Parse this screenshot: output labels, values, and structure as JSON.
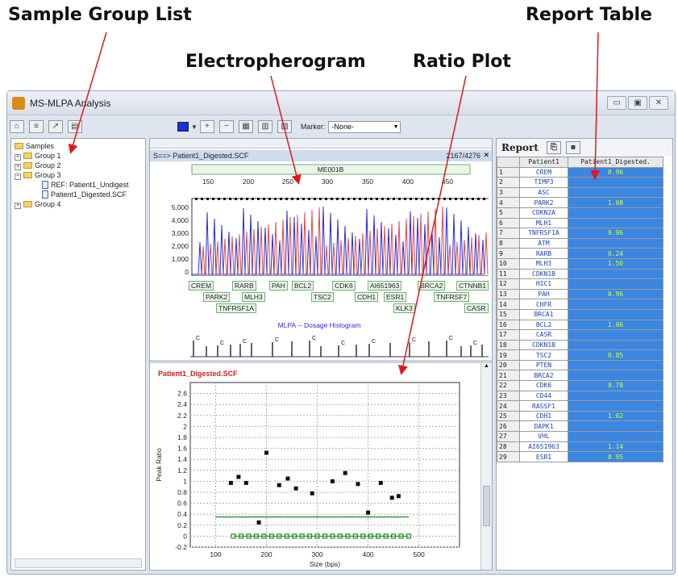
{
  "callouts": {
    "sample_group_list": "Sample Group List",
    "report_table": "Report Table",
    "electropherogram": "Electropherogram",
    "ratio_plot": "Ratio Plot"
  },
  "window": {
    "title": "MS-MLPA Analysis",
    "controls": [
      "▭",
      "▣",
      "✕"
    ]
  },
  "toolbar": {
    "marker_label": "Marker:",
    "marker_value": "-None-",
    "color_swatch": "#1c2fd6"
  },
  "tree": {
    "root": "Samples",
    "items": [
      {
        "label": "Group 1",
        "type": "folder"
      },
      {
        "label": "Group 2",
        "type": "folder"
      },
      {
        "label": "Group 3",
        "type": "folder"
      },
      {
        "label": "REF: Patient1_Undigest",
        "type": "doc"
      },
      {
        "label": "Patient1_Digested.SCF",
        "type": "doc"
      },
      {
        "label": "Group 4",
        "type": "folder"
      }
    ]
  },
  "electro": {
    "header": "S==> Patient1_Digested.SCF",
    "count": "2167/4276",
    "kit": "ME001B",
    "size_ticks": [
      "150",
      "200",
      "250",
      "300",
      "350",
      "400",
      "450"
    ],
    "y_ticks": [
      "5,000",
      "4,000",
      "3,000",
      "2,000",
      "1,000",
      "0"
    ],
    "probes_row1": [
      "CREM",
      "RARB",
      "PAH",
      "BCL2",
      "CDK6",
      "AI651963",
      "BRCA2",
      "CTNNB1"
    ],
    "probes_row2": [
      "PARK2",
      "MLH3",
      "TSC2",
      "CDH1",
      "ESR1",
      "TNFRSF7"
    ],
    "probes_row3": [
      "TNFRSF1A",
      "KLK3",
      "CASR"
    ],
    "histogram_title": "MLPA -- Dosage Histogram",
    "histogram_letter": "C",
    "colors": {
      "blue": "#2b2bd8",
      "red": "#e24a4a"
    }
  },
  "ratio": {
    "title": "Patient1_Digested.SCF",
    "title_color": "#d22020"
  },
  "chart_data": {
    "type": "scatter",
    "title": "",
    "xlabel": "Size (bps)",
    "ylabel": "Peak Ratio",
    "xlim": [
      50,
      580
    ],
    "ylim": [
      -0.2,
      2.8
    ],
    "x_ticks": [
      100,
      200,
      300,
      400,
      500
    ],
    "y_ticks": [
      -0.2,
      0,
      0.2,
      0.4,
      0.6,
      0.8,
      1,
      1.2,
      1.4,
      1.6,
      1.8,
      2,
      2.2,
      2.4,
      2.6
    ],
    "grid": true,
    "series": [
      {
        "marker": "square",
        "color": "#111111",
        "x": [
          130,
          145,
          160,
          185,
          200,
          225,
          242,
          258,
          290,
          300,
          330,
          355,
          380,
          400,
          425,
          447,
          460
        ],
        "y": [
          0.97,
          1.08,
          0.97,
          0.25,
          1.52,
          0.93,
          1.05,
          0.87,
          0.78,
          0.0,
          1.0,
          1.15,
          0.95,
          0.43,
          0.97,
          0.7,
          0.73
        ]
      },
      {
        "marker": "square",
        "color": "#1e8a1e",
        "x": [
          135,
          150,
          165,
          180,
          195,
          210,
          225,
          240,
          255,
          270,
          285,
          300,
          315,
          330,
          345,
          360,
          375,
          390,
          405,
          420,
          435,
          450,
          465,
          480
        ],
        "y": [
          0,
          0,
          0,
          0,
          0,
          0,
          0,
          0,
          0,
          0,
          0,
          0,
          0,
          0,
          0,
          0,
          0,
          0,
          0,
          0,
          0,
          0,
          0,
          0
        ]
      }
    ],
    "reference_line": {
      "y": 0.35,
      "x_from": 100,
      "x_to": 480,
      "color": "#1e8a1e"
    }
  },
  "report": {
    "title": "Report",
    "col_gene": "Patient1",
    "col_value": "Patient1_Digested.",
    "rows": [
      {
        "n": "1",
        "gene": "CREM",
        "val": "0.96"
      },
      {
        "n": "2",
        "gene": "TIMP3",
        "val": ""
      },
      {
        "n": "3",
        "gene": "ASC",
        "val": ""
      },
      {
        "n": "4",
        "gene": "PARK2",
        "val": "1.08"
      },
      {
        "n": "5",
        "gene": "CDKN2A",
        "val": ""
      },
      {
        "n": "6",
        "gene": "MLH1",
        "val": ""
      },
      {
        "n": "7",
        "gene": "TNFRSF1A",
        "val": "0.96"
      },
      {
        "n": "8",
        "gene": "ATM",
        "val": ""
      },
      {
        "n": "9",
        "gene": "RARB",
        "val": "0.24"
      },
      {
        "n": "10",
        "gene": "MLH3",
        "val": "1.50"
      },
      {
        "n": "11",
        "gene": "CDKN1B",
        "val": ""
      },
      {
        "n": "12",
        "gene": "HIC1",
        "val": ""
      },
      {
        "n": "13",
        "gene": "PAH",
        "val": "0.96"
      },
      {
        "n": "14",
        "gene": "CHFR",
        "val": ""
      },
      {
        "n": "15",
        "gene": "BRCA1",
        "val": ""
      },
      {
        "n": "16",
        "gene": "BCL2",
        "val": "1.06"
      },
      {
        "n": "17",
        "gene": "CASR",
        "val": ""
      },
      {
        "n": "18",
        "gene": "CDKN1B",
        "val": ""
      },
      {
        "n": "19",
        "gene": "TSC2",
        "val": "0.85"
      },
      {
        "n": "20",
        "gene": "PTEN",
        "val": ""
      },
      {
        "n": "21",
        "gene": "BRCA2",
        "val": ""
      },
      {
        "n": "22",
        "gene": "CDK6",
        "val": "0.78"
      },
      {
        "n": "23",
        "gene": "CD44",
        "val": ""
      },
      {
        "n": "24",
        "gene": "RASSF1",
        "val": ""
      },
      {
        "n": "25",
        "gene": "CDH1",
        "val": "1.02"
      },
      {
        "n": "26",
        "gene": "DAPK1",
        "val": ""
      },
      {
        "n": "27",
        "gene": "VHL",
        "val": ""
      },
      {
        "n": "28",
        "gene": "AI651963",
        "val": "1.14"
      },
      {
        "n": "29",
        "gene": "ESR1",
        "val": "0.95"
      }
    ]
  }
}
